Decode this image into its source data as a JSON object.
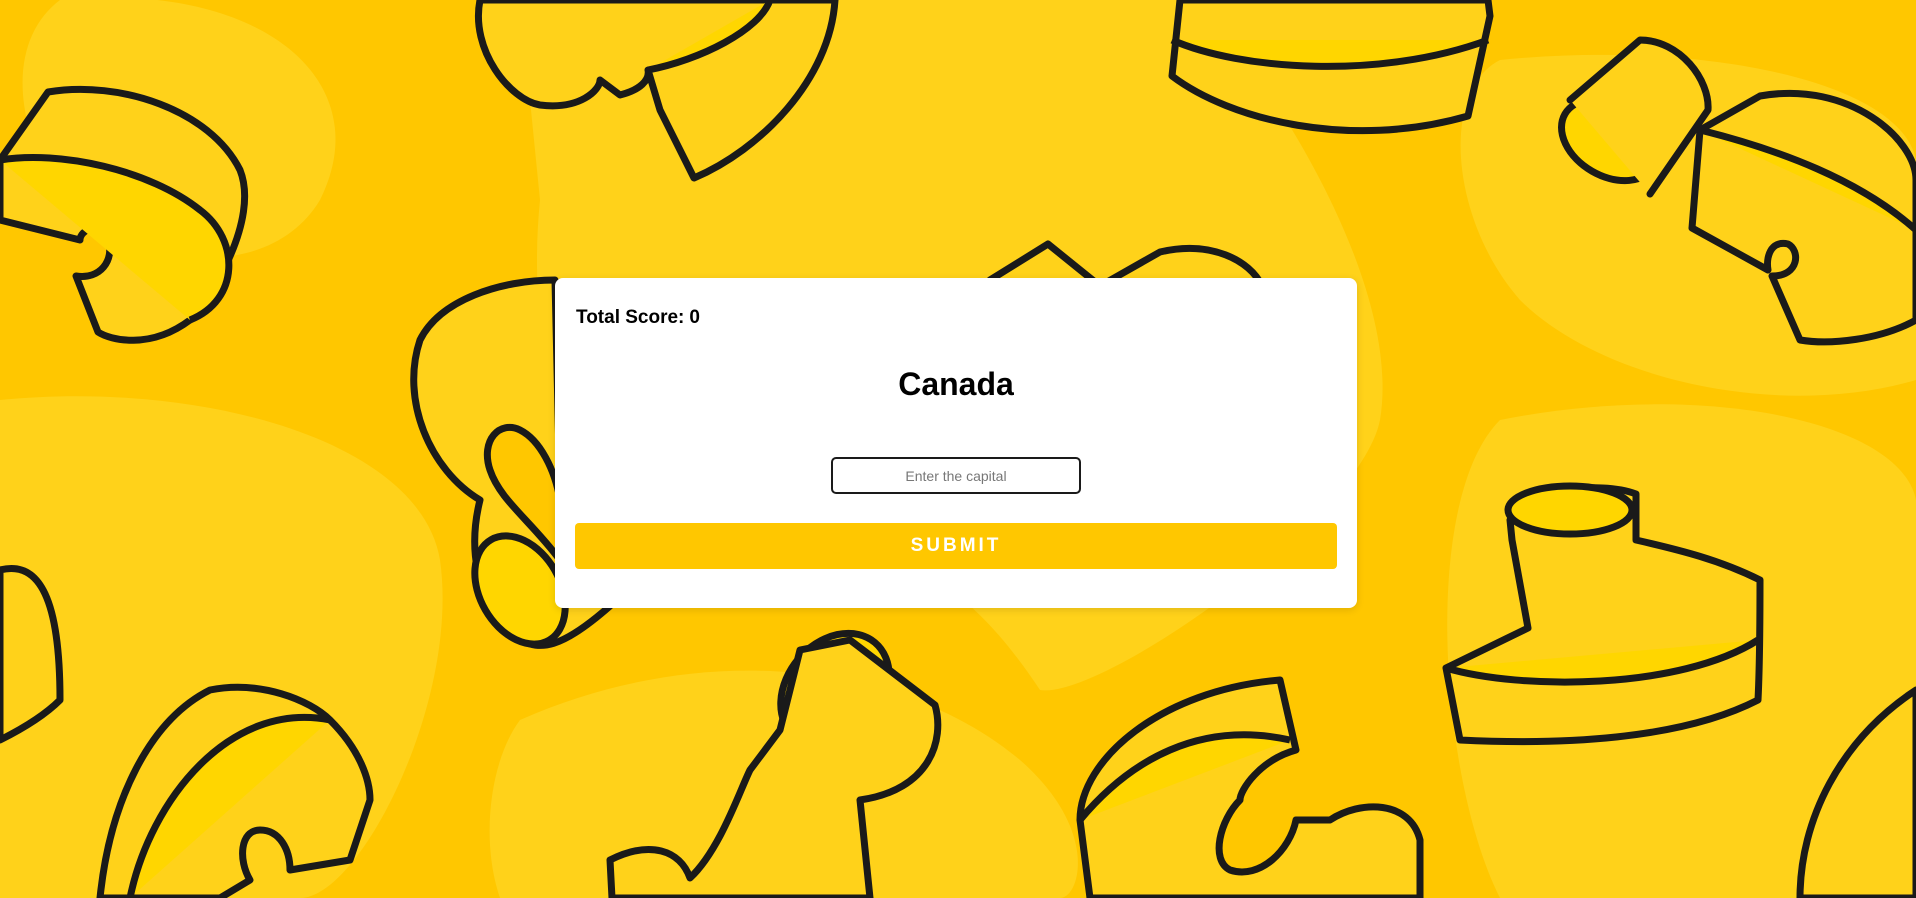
{
  "quiz": {
    "score_label": "Total Score:",
    "score_value": "0",
    "country": "Canada",
    "answer_placeholder": "Enter the capital",
    "answer_value": "",
    "submit_label": "SUBMIT"
  },
  "theme": {
    "background": "#ffc700",
    "button": "#ffc700",
    "card": "#ffffff",
    "outline": "#1a1a1a"
  }
}
